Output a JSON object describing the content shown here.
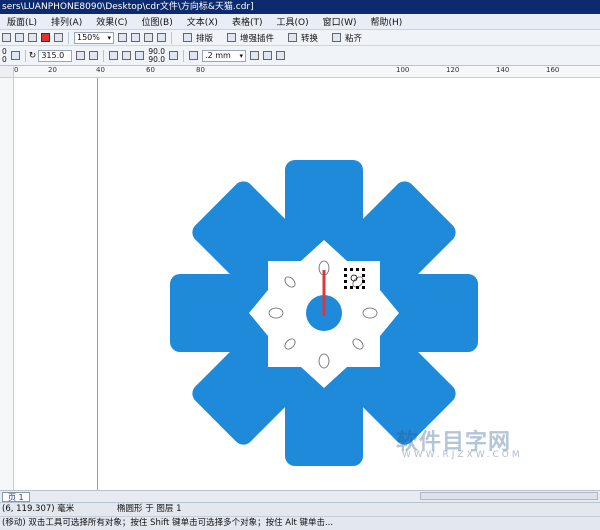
{
  "window": {
    "title": "sers\\LUANPHONE8090\\Desktop\\cdr文件\\方向标&天猫.cdr]"
  },
  "menu": [
    "版面(L)",
    "排列(A)",
    "效果(C)",
    "位图(B)",
    "文本(X)",
    "表格(T)",
    "工具(O)",
    "窗口(W)",
    "帮助(H)"
  ],
  "toolbar": {
    "zoom": "150%",
    "plugins": [
      {
        "label": "排版"
      },
      {
        "label": "增强插件"
      },
      {
        "label": "转换"
      },
      {
        "label": "粘齐"
      }
    ]
  },
  "propbar": {
    "x_val": "0",
    "y_val": "0",
    "rotation": "315.0",
    "size_w": "90.0",
    "size_h": "90.0",
    "outline": ".2 mm"
  },
  "ruler": {
    "h_ticks": [
      "0",
      "20",
      "40",
      "60",
      "80",
      "100",
      "120",
      "140",
      "160"
    ]
  },
  "page_tab": "页 1",
  "status": {
    "coords": "(6, 119.307)",
    "unit": "毫米",
    "object_info": "椭圆形 于 图层 1",
    "hint_prefix": "(移动)",
    "hint": "双击工具可选择所有对象；按住 Shift 键单击可选择多个对象；按住 Alt 键单击..."
  },
  "watermark": {
    "text": "软件目字网",
    "sub": "WWW.RJZXW.COM"
  },
  "colors": {
    "shape_blue": "#1f8ad9",
    "hand_red": "#d9393b",
    "title_bar": "#0d2a6e"
  }
}
